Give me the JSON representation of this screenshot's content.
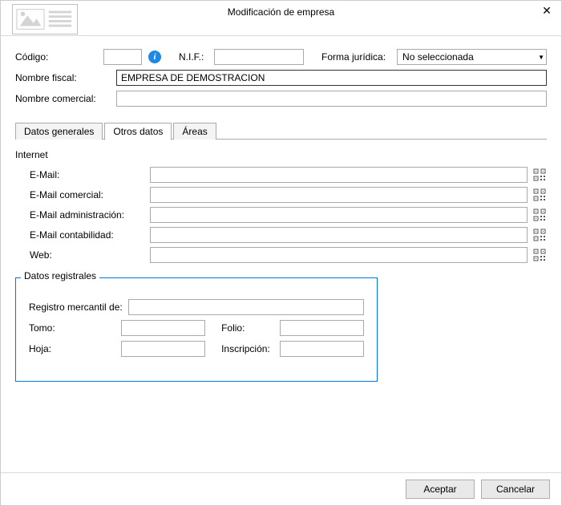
{
  "window": {
    "title": "Modificación de empresa"
  },
  "header": {
    "codigo_label": "Código:",
    "codigo_value": "",
    "nif_label": "N.I.F.:",
    "nif_value": "",
    "forma_label": "Forma jurídica:",
    "forma_value": "No seleccionada",
    "nombre_fiscal_label": "Nombre fiscal:",
    "nombre_fiscal_value": "EMPRESA DE DEMOSTRACION",
    "nombre_comercial_label": "Nombre comercial:",
    "nombre_comercial_value": ""
  },
  "tabs": {
    "t1": "Datos generales",
    "t2": "Otros datos",
    "t3": "Áreas"
  },
  "internet": {
    "group": "Internet",
    "email_label": "E-Mail:",
    "email_value": "",
    "email_com_label": "E-Mail comercial:",
    "email_com_value": "",
    "email_admin_label": "E-Mail administración:",
    "email_admin_value": "",
    "email_cont_label": "E-Mail contabilidad:",
    "email_cont_value": "",
    "web_label": "Web:",
    "web_value": ""
  },
  "registrales": {
    "legend": "Datos registrales",
    "registro_label": "Registro mercantil de:",
    "registro_value": "",
    "tomo_label": "Tomo:",
    "tomo_value": "",
    "folio_label": "Folio:",
    "folio_value": "",
    "hoja_label": "Hoja:",
    "hoja_value": "",
    "inscripcion_label": "Inscripción:",
    "inscripcion_value": ""
  },
  "buttons": {
    "accept": "Aceptar",
    "cancel": "Cancelar"
  }
}
